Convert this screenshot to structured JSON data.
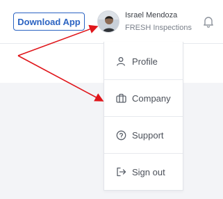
{
  "header": {
    "download_button_label": "Download App",
    "user": {
      "name": "Israel Mendoza",
      "organization": "FRESH Inspections"
    }
  },
  "user_menu": {
    "items": [
      {
        "label": "Profile",
        "icon": "user-icon"
      },
      {
        "label": "Company",
        "icon": "briefcase-icon"
      },
      {
        "label": "Support",
        "icon": "help-circle-icon"
      },
      {
        "label": "Sign out",
        "icon": "sign-out-icon"
      }
    ]
  },
  "colors": {
    "accent": "#2b63c2",
    "annotation_arrow": "#e0161b"
  },
  "icons": {
    "notifications": "bell-icon"
  }
}
